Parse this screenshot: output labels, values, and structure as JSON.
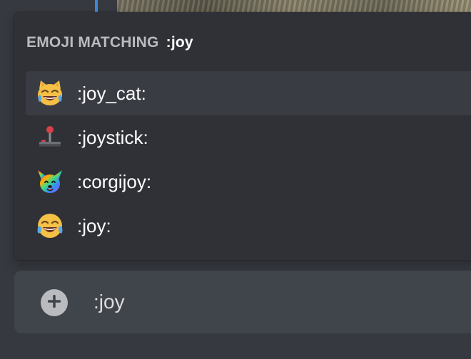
{
  "autocomplete": {
    "header_label": "EMOJI MATCHING",
    "header_query": ":joy",
    "items": [
      {
        "label": ":joy_cat:",
        "icon": "joy-cat-emoji",
        "selected": true
      },
      {
        "label": ":joystick:",
        "icon": "joystick-emoji",
        "selected": false
      },
      {
        "label": ":corgijoy:",
        "icon": "rainbow-corgi-emoji",
        "selected": false
      },
      {
        "label": ":joy:",
        "icon": "joy-face-emoji",
        "selected": false
      }
    ]
  },
  "composer": {
    "attach_icon": "plus-circle-icon",
    "message_text": ":joy"
  },
  "colors": {
    "background": "#36393f",
    "popup": "#2f3136",
    "selected_row": "#393c43",
    "input": "#40444b",
    "header_text": "#b9bbbe",
    "accent_marker": "#3a88dc"
  }
}
